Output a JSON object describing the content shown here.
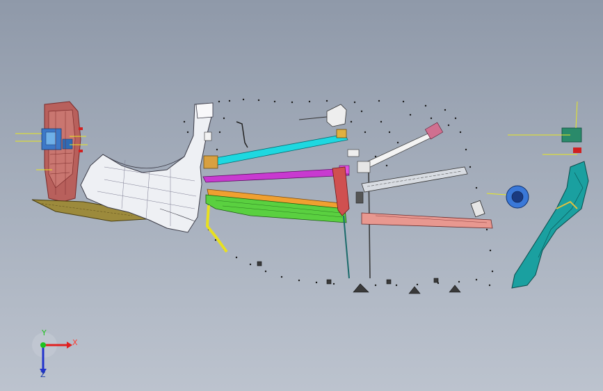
{
  "view": {
    "background_top": "#8f99a9",
    "background_bottom": "#bcc3ce"
  },
  "triad": {
    "x_label": "X",
    "y_label": "Y",
    "z_label": "Z",
    "x_color": "#e02020",
    "y_color": "#1ec21e",
    "z_color": "#2233cc"
  },
  "parts": [
    {
      "name": "door-inner-panel",
      "color": "#c05a58"
    },
    {
      "name": "rear-wheel-arch-panel",
      "color": "#f2f4f8"
    },
    {
      "name": "roof-rail-cyan",
      "color": "#1ed8e0"
    },
    {
      "name": "side-rail-magenta",
      "color": "#c83ad0"
    },
    {
      "name": "side-sill-orange",
      "color": "#f0a030"
    },
    {
      "name": "side-sill-green",
      "color": "#5ad040"
    },
    {
      "name": "strut-white",
      "color": "#f4f4f4"
    },
    {
      "name": "rail-grey",
      "color": "#d8dce2"
    },
    {
      "name": "floor-member-pink",
      "color": "#e89890"
    },
    {
      "name": "fuel-filler-blue",
      "color": "#3a78d8"
    },
    {
      "name": "a-pillar-teal",
      "color": "#1aa0a0"
    }
  ]
}
